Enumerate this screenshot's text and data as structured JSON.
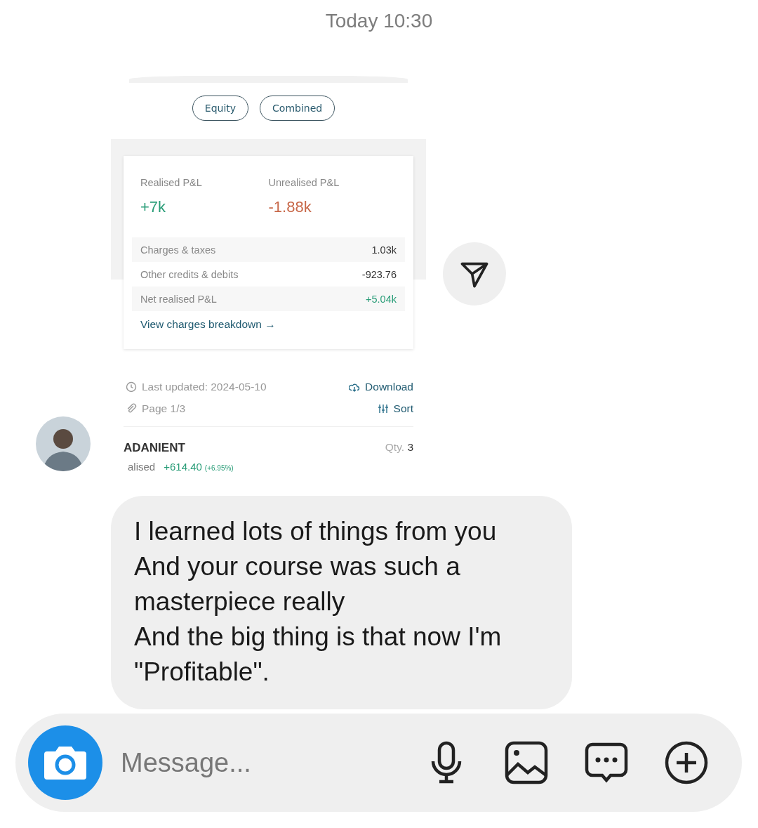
{
  "timestamp": "Today 10:30",
  "shared_screenshot": {
    "filter_chips": [
      {
        "label": "Equity"
      },
      {
        "label": "Combined"
      }
    ],
    "summary": [
      {
        "label": "Realised P&L",
        "value": "+7k",
        "color": "#2a9d78"
      },
      {
        "label": "Unrealised P&L",
        "value": "-1.88k",
        "color": "#c8694a"
      }
    ],
    "rows": [
      {
        "label": "Charges & taxes",
        "value": "1.03k",
        "color": "#333333"
      },
      {
        "label": "Other credits & debits",
        "value": "-923.76",
        "color": "#333333"
      },
      {
        "label": "Net realised P&L",
        "value": "+5.04k",
        "color": "#2a9d78"
      }
    ],
    "breakdown_link": "View charges breakdown →",
    "last_updated": "Last updated: 2024-05-10",
    "download": "Download",
    "page": "Page 1/3",
    "sort": "Sort",
    "holding": {
      "symbol": "ADANIENT",
      "qty_label": "Qty.",
      "qty": "3",
      "pnl_label": "alised",
      "pnl": "+614.40",
      "pnl_pct": "(+6.95%)"
    }
  },
  "message": "I learned lots of things from you\nAnd your course was such a masterpiece really\nAnd the big thing is that now I'm \"Profitable\".",
  "composer": {
    "placeholder": "Message..."
  }
}
